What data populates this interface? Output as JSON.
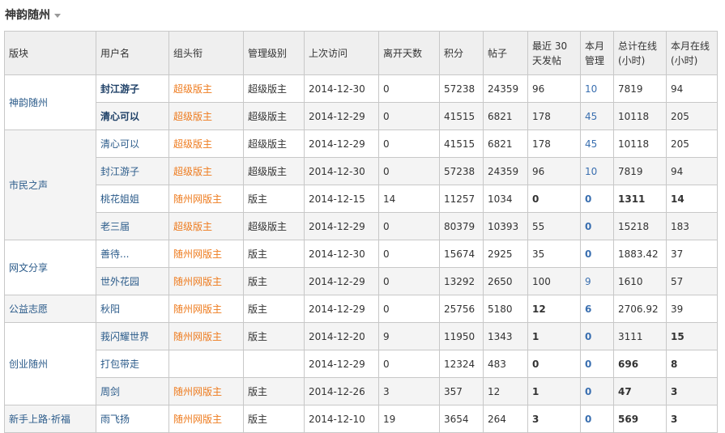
{
  "page": {
    "title": "神韵随州"
  },
  "headers": [
    "版块",
    "用户名",
    "组头衔",
    "管理级别",
    "上次访问",
    "离开天数",
    "积分",
    "帖子",
    "最近 30 天发帖",
    "本月管理",
    "总计在线(小时)",
    "本月在线(小时)"
  ],
  "groups": [
    {
      "board": "神韵随州",
      "rows": [
        {
          "user": "封江游子",
          "user_bold": true,
          "title": "超级版主",
          "level": "超级版主",
          "last": "2014-12-30",
          "days": "0",
          "points": "57238",
          "posts": "24359",
          "p30": "96",
          "mgmt": "10",
          "total": "7819",
          "month": "94"
        },
        {
          "user": "清心可以",
          "user_bold": true,
          "title": "超级版主",
          "level": "超级版主",
          "last": "2014-12-29",
          "days": "0",
          "points": "41515",
          "posts": "6821",
          "p30": "178",
          "mgmt": "45",
          "total": "10118",
          "month": "205"
        }
      ]
    },
    {
      "board": "市民之声",
      "rows": [
        {
          "user": "清心可以",
          "title": "超级版主",
          "level": "超级版主",
          "last": "2014-12-29",
          "days": "0",
          "points": "41515",
          "posts": "6821",
          "p30": "178",
          "mgmt": "45",
          "total": "10118",
          "month": "205"
        },
        {
          "user": "封江游子",
          "title": "超级版主",
          "level": "超级版主",
          "last": "2014-12-30",
          "days": "0",
          "points": "57238",
          "posts": "24359",
          "p30": "96",
          "mgmt": "10",
          "total": "7819",
          "month": "94"
        },
        {
          "user": "桃花姐姐",
          "title": "随州网版主",
          "level": "版主",
          "last": "2014-12-15",
          "days": "14",
          "points": "11257",
          "posts": "1034",
          "p30": "0",
          "p30_bold": true,
          "mgmt": "0",
          "mgmt_bold": true,
          "total": "1311",
          "total_bold": true,
          "month": "14",
          "month_bold": true
        },
        {
          "user": "老三届",
          "title": "超级版主",
          "level": "超级版主",
          "last": "2014-12-29",
          "days": "0",
          "points": "80379",
          "posts": "10393",
          "p30": "55",
          "mgmt": "0",
          "mgmt_bold": true,
          "total": "15218",
          "month": "183"
        }
      ]
    },
    {
      "board": "网文分享",
      "rows": [
        {
          "user": "善待...",
          "title": "随州网版主",
          "level": "版主",
          "last": "2014-12-30",
          "days": "0",
          "points": "15674",
          "posts": "2925",
          "p30": "35",
          "mgmt": "0",
          "mgmt_bold": true,
          "total": "1883.42",
          "month": "37"
        },
        {
          "user": "世外花园",
          "title": "随州网版主",
          "level": "版主",
          "last": "2014-12-29",
          "days": "0",
          "points": "13292",
          "posts": "2650",
          "p30": "100",
          "mgmt": "9",
          "total": "1610",
          "month": "57"
        }
      ]
    },
    {
      "board": "公益志愿",
      "rows": [
        {
          "user": "秋阳",
          "title": "随州网版主",
          "level": "版主",
          "last": "2014-12-29",
          "days": "0",
          "points": "25756",
          "posts": "5180",
          "p30": "12",
          "p30_bold": true,
          "mgmt": "6",
          "mgmt_bold": true,
          "total": "2706.92",
          "month": "39"
        }
      ]
    },
    {
      "board": "创业随州",
      "rows": [
        {
          "user": "莪闪耀世界",
          "title": "随州网版主",
          "level": "版主",
          "last": "2014-12-20",
          "days": "9",
          "points": "11950",
          "posts": "1343",
          "p30": "1",
          "p30_bold": true,
          "mgmt": "0",
          "mgmt_bold": true,
          "total": "3111",
          "month": "15",
          "month_bold": true
        },
        {
          "user": "打包带走",
          "title": "",
          "level": "",
          "last": "2014-12-29",
          "days": "0",
          "points": "12324",
          "posts": "483",
          "p30": "0",
          "p30_bold": true,
          "mgmt": "0",
          "mgmt_bold": true,
          "total": "696",
          "total_bold": true,
          "month": "8",
          "month_bold": true
        },
        {
          "user": "周剑",
          "title": "随州网版主",
          "level": "版主",
          "last": "2014-12-26",
          "days": "3",
          "points": "357",
          "posts": "12",
          "p30": "1",
          "p30_bold": true,
          "mgmt": "0",
          "mgmt_bold": true,
          "total": "47",
          "total_bold": true,
          "month": "3",
          "month_bold": true
        }
      ]
    },
    {
      "board": "新手上路·祈福",
      "rows": [
        {
          "user": "雨飞扬",
          "title": "随州网版主",
          "level": "版主",
          "last": "2014-12-10",
          "days": "19",
          "points": "3654",
          "posts": "264",
          "p30": "3",
          "p30_bold": true,
          "mgmt": "0",
          "mgmt_bold": true,
          "total": "569",
          "total_bold": true,
          "month": "3",
          "month_bold": true
        }
      ]
    }
  ]
}
